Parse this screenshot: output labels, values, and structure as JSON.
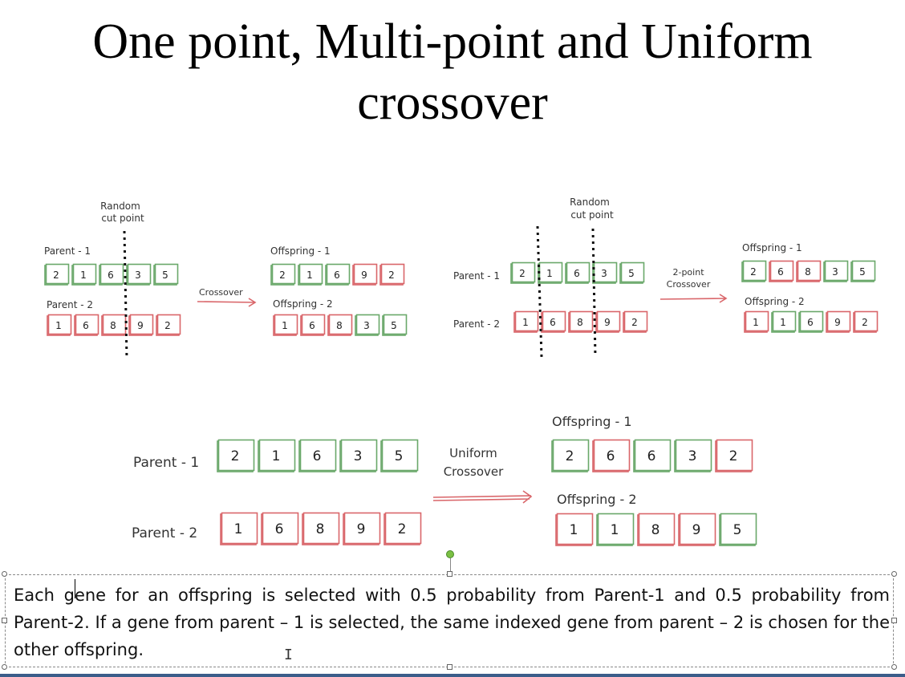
{
  "slide": {
    "title_line1": "One point, Multi-point and  Uniform",
    "title_line2": "crossover",
    "description": "Each gene for an offspring is selected with 0.5 probability from Parent-1 and 0.5 probability from Parent-2. If a gene from parent – 1 is selected, the same indexed gene from parent – 2 is chosen for the other offspring."
  },
  "colors": {
    "parent1": "#6aa86a",
    "parent2": "#d9666a",
    "arrow": "#d9666a"
  },
  "one_point": {
    "cut_label": [
      "Random",
      "cut point"
    ],
    "parent1_label": "Parent - 1",
    "parent2_label": "Parent - 2",
    "operation_label": "Crossover",
    "offspring1_label": "Offspring - 1",
    "offspring2_label": "Offspring - 2",
    "parent1": {
      "values": [
        "2",
        "1",
        "6",
        "3",
        "5"
      ],
      "colors": [
        "g",
        "g",
        "g",
        "g",
        "g"
      ]
    },
    "parent2": {
      "values": [
        "1",
        "6",
        "8",
        "9",
        "2"
      ],
      "colors": [
        "r",
        "r",
        "r",
        "r",
        "r"
      ]
    },
    "offspring1": {
      "values": [
        "2",
        "1",
        "6",
        "9",
        "2"
      ],
      "colors": [
        "g",
        "g",
        "g",
        "r",
        "r"
      ]
    },
    "offspring2": {
      "values": [
        "1",
        "6",
        "8",
        "3",
        "5"
      ],
      "colors": [
        "r",
        "r",
        "r",
        "g",
        "g"
      ]
    }
  },
  "two_point": {
    "cut_label": [
      "Random",
      "cut point"
    ],
    "parent1_label": "Parent - 1",
    "parent2_label": "Parent - 2",
    "operation_label": [
      "2-point",
      "Crossover"
    ],
    "offspring1_label": "Offspring - 1",
    "offspring2_label": "Offspring - 2",
    "parent1": {
      "values": [
        "2",
        "1",
        "6",
        "3",
        "5"
      ],
      "colors": [
        "g",
        "g",
        "g",
        "g",
        "g"
      ]
    },
    "parent2": {
      "values": [
        "1",
        "6",
        "8",
        "9",
        "2"
      ],
      "colors": [
        "r",
        "r",
        "r",
        "r",
        "r"
      ]
    },
    "offspring1": {
      "values": [
        "2",
        "6",
        "8",
        "3",
        "5"
      ],
      "colors": [
        "g",
        "r",
        "r",
        "g",
        "g"
      ]
    },
    "offspring2": {
      "values": [
        "1",
        "1",
        "6",
        "9",
        "2"
      ],
      "colors": [
        "r",
        "g",
        "g",
        "r",
        "r"
      ]
    }
  },
  "uniform": {
    "parent1_label": "Parent - 1",
    "parent2_label": "Parent - 2",
    "operation_label": [
      "Uniform",
      "Crossover"
    ],
    "offspring1_label": "Offspring - 1",
    "offspring2_label": "Offspring - 2",
    "parent1": {
      "values": [
        "2",
        "1",
        "6",
        "3",
        "5"
      ],
      "colors": [
        "g",
        "g",
        "g",
        "g",
        "g"
      ]
    },
    "parent2": {
      "values": [
        "1",
        "6",
        "8",
        "9",
        "2"
      ],
      "colors": [
        "r",
        "r",
        "r",
        "r",
        "r"
      ]
    },
    "offspring1": {
      "values": [
        "2",
        "6",
        "6",
        "3",
        "2"
      ],
      "colors": [
        "g",
        "r",
        "g",
        "g",
        "r"
      ]
    },
    "offspring2": {
      "values": [
        "1",
        "1",
        "8",
        "9",
        "5"
      ],
      "colors": [
        "r",
        "g",
        "r",
        "r",
        "g"
      ]
    }
  }
}
